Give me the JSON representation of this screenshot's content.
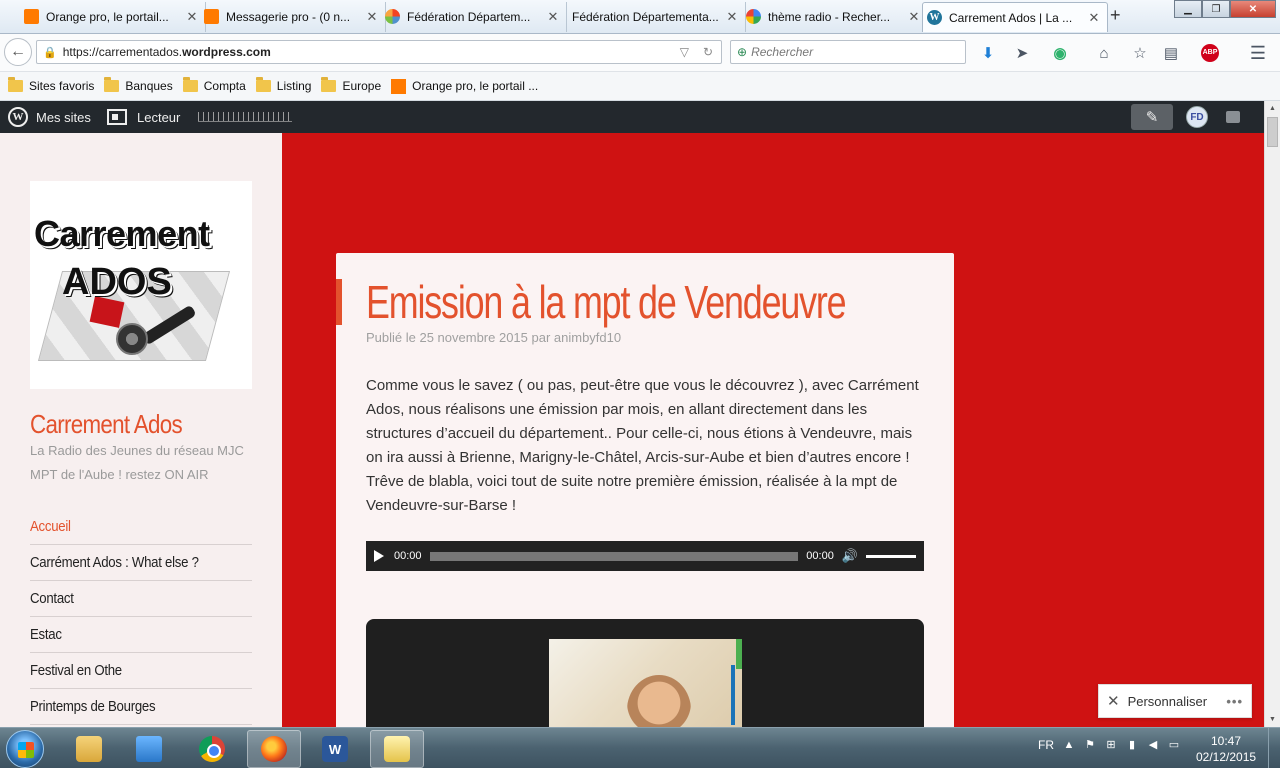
{
  "browser": {
    "tabs": [
      {
        "label": "Orange pro, le portail...",
        "favicon": "orange-square-icon"
      },
      {
        "label": "Messagerie pro - (0 n...",
        "favicon": "orange-square-icon"
      },
      {
        "label": "Fédération Départem...",
        "favicon": "joomla-icon"
      },
      {
        "label": "Fédération Départementa...",
        "favicon": "none"
      },
      {
        "label": "thème radio - Recher...",
        "favicon": "google-icon"
      },
      {
        "label": "Carrement Ados | La ...",
        "favicon": "wordpress-icon",
        "active": true
      }
    ],
    "url_prefix": "https://carrementados.",
    "url_domain": "wordpress.com",
    "search_placeholder": "Rechercher",
    "adblock_label": "ABP",
    "bookmarks": [
      {
        "label": "Sites favoris",
        "icon": "folder-icon"
      },
      {
        "label": "Banques",
        "icon": "folder-icon"
      },
      {
        "label": "Compta",
        "icon": "folder-icon"
      },
      {
        "label": "Listing",
        "icon": "folder-icon"
      },
      {
        "label": "Europe",
        "icon": "folder-icon"
      },
      {
        "label": "Orange pro, le portail ...",
        "icon": "orange-square-icon"
      }
    ]
  },
  "adminbar": {
    "my_sites": "Mes sites",
    "reader": "Lecteur",
    "avatar_initials": "FD"
  },
  "site": {
    "logo_line1": "Carrement",
    "logo_line2": "ADOS",
    "title": "Carrement Ados",
    "description": "La Radio des Jeunes du réseau MJC MPT de l'Aube ! restez ON AIR",
    "menu": [
      {
        "label": "Accueil",
        "current": true
      },
      {
        "label": "Carrément Ados : What else ?"
      },
      {
        "label": "Contact"
      },
      {
        "label": "Estac"
      },
      {
        "label": "Festival en Othe"
      },
      {
        "label": "Printemps de Bourges"
      }
    ]
  },
  "post": {
    "title": "Emission à la mpt de Vendeuvre",
    "meta": "Publié le 25 novembre 2015 par animbyfd10",
    "body": "Comme vous le savez ( ou pas, peut-être que vous le découvrez ), avec Carrément Ados, nous réalisons une émission par mois, en allant directement dans les structures d’accueil du département.. Pour celle-ci, nous étions à Vendeuvre, mais on ira aussi à Brienne, Marigny-le-Châtel, Arcis-sur-Aube et bien d’autres encore ! Trêve de blabla, voici tout de suite notre première émission, réalisée à la mpt de Vendeuvre-sur-Barse !",
    "audio": {
      "current_time": "00:00",
      "duration": "00:00"
    }
  },
  "customize_label": "Personnaliser",
  "taskbar": {
    "language": "FR",
    "time": "10:47",
    "date": "02/12/2015"
  },
  "colors": {
    "accent": "#e3522d",
    "background_red": "#cf1212",
    "adminbar": "#23282d"
  }
}
